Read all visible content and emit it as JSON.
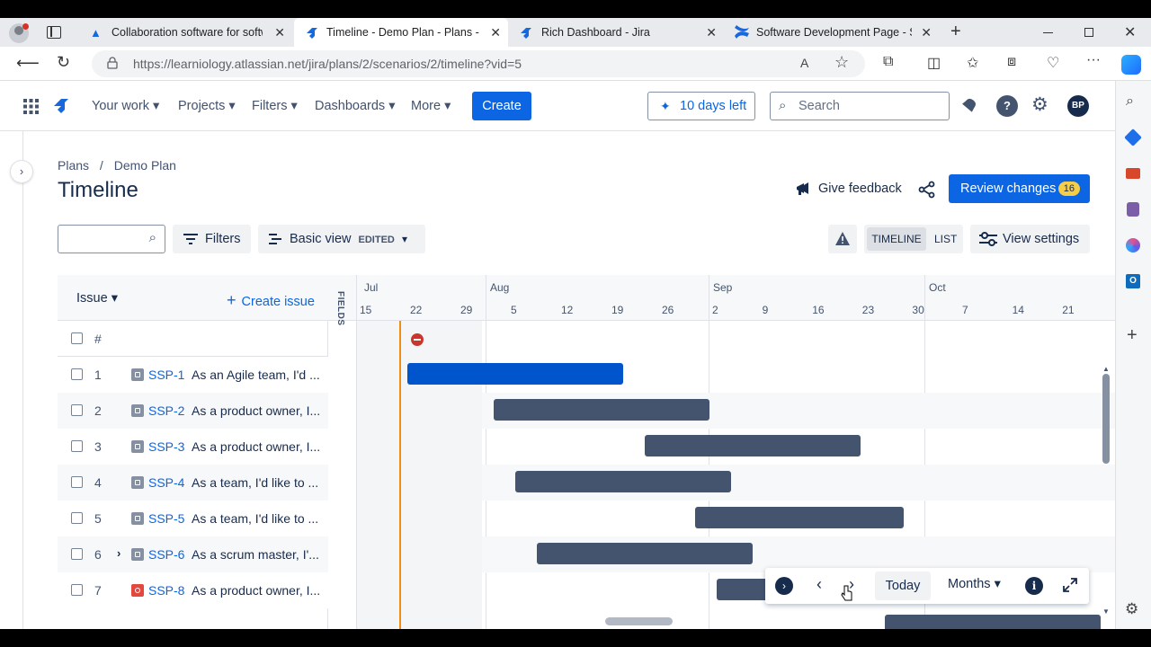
{
  "browser": {
    "tabs": [
      {
        "label": "Collaboration software for softw",
        "icon": "confluence-icon"
      },
      {
        "label": "Timeline - Demo Plan - Plans - Ji",
        "icon": "jira-icon",
        "active": true
      },
      {
        "label": "Rich Dashboard - Jira",
        "icon": "jira-icon"
      },
      {
        "label": "Software Development Page - Sc",
        "icon": "confluence-icon"
      }
    ],
    "url": "https://learniology.atlassian.net/jira/plans/2/scenarios/2/timeline?vid=5"
  },
  "nav": {
    "items": [
      "Your work",
      "Projects",
      "Filters",
      "Dashboards",
      "More"
    ],
    "create": "Create",
    "trial": "10 days left",
    "search_placeholder": "Search",
    "avatar": "BP"
  },
  "page": {
    "breadcrumb_root": "Plans",
    "breadcrumb_sep": "/",
    "breadcrumb_current": "Demo Plan",
    "title": "Timeline",
    "feedback": "Give feedback",
    "review": "Review changes",
    "review_count": "16"
  },
  "toolbar": {
    "filters": "Filters",
    "view": "Basic view",
    "edited": "EDITED",
    "timeline": "TIMELINE",
    "list": "LIST",
    "view_settings": "View settings"
  },
  "table": {
    "issue_header": "Issue",
    "create_issue": "Create issue",
    "hash": "#",
    "fields": "FIELDS",
    "rows": [
      {
        "num": "1",
        "key": "SSP-1",
        "summary": "As an Agile team, I'd ...",
        "type": "story",
        "expand": false
      },
      {
        "num": "2",
        "key": "SSP-2",
        "summary": "As a product owner, I...",
        "type": "story",
        "expand": false
      },
      {
        "num": "3",
        "key": "SSP-3",
        "summary": "As a product owner, I...",
        "type": "story",
        "expand": false
      },
      {
        "num": "4",
        "key": "SSP-4",
        "summary": "As a team, I'd like to ...",
        "type": "story",
        "expand": false
      },
      {
        "num": "5",
        "key": "SSP-5",
        "summary": "As a team, I'd like to ...",
        "type": "story",
        "expand": false
      },
      {
        "num": "6",
        "key": "SSP-6",
        "summary": "As a scrum master, I'...",
        "type": "story",
        "expand": true
      },
      {
        "num": "7",
        "key": "SSP-8",
        "summary": "As a product owner, I...",
        "type": "bug",
        "expand": false
      }
    ]
  },
  "timeline": {
    "months": [
      "Jul",
      "Aug",
      "Sep",
      "Oct"
    ],
    "days": [
      "15",
      "22",
      "29",
      "5",
      "12",
      "19",
      "26",
      "2",
      "9",
      "16",
      "23",
      "30",
      "7",
      "14",
      "21"
    ],
    "bars": [
      {
        "key": "SSP-1",
        "start": "2024-07-22",
        "end": "2024-08-21",
        "selected": true
      },
      {
        "key": "SSP-2",
        "start": "2024-08-03",
        "end": "2024-09-02"
      },
      {
        "key": "SSP-3",
        "start": "2024-08-24",
        "end": "2024-09-23"
      },
      {
        "key": "SSP-4",
        "start": "2024-08-06",
        "end": "2024-09-05"
      },
      {
        "key": "SSP-5",
        "start": "2024-08-31",
        "end": "2024-09-29"
      },
      {
        "key": "SSP-6",
        "start": "2024-08-09",
        "end": "2024-09-08"
      },
      {
        "key": "SSP-8",
        "start": "2024-09-03",
        "end": "2024-10-03"
      }
    ],
    "controls": {
      "today": "Today",
      "scale": "Months"
    }
  },
  "colors": {
    "primary": "#0c66e4",
    "bar": "#44546f",
    "selected_bar": "#0055cc",
    "today": "#f18d13",
    "badge": "#f5cd47"
  }
}
